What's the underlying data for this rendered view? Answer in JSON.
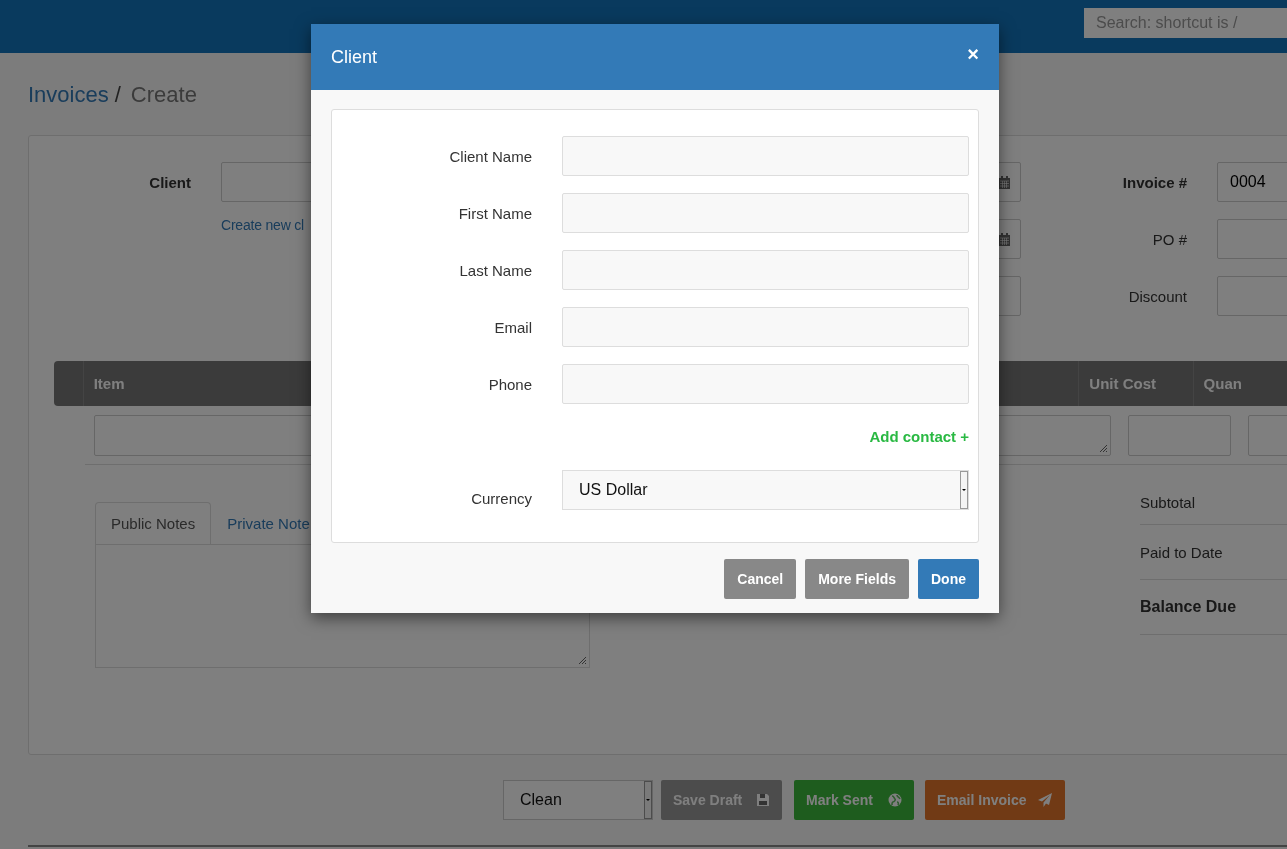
{
  "navbar": {
    "search": {
      "placeholder": "Search: shortcut is /"
    }
  },
  "breadcrumb": [
    {
      "label": "Invoices",
      "kind": "link"
    },
    {
      "label": "/",
      "kind": "separator"
    },
    {
      "label": "Create",
      "kind": "current"
    }
  ],
  "invoice_form": {
    "client": {
      "label": "Client",
      "link": "Create new cl"
    },
    "date_fields": [
      {
        "kind": "date"
      },
      {
        "kind": "date"
      },
      {
        "kind": "plain"
      }
    ],
    "right_fields": [
      {
        "label": "Invoice #",
        "value": "0004",
        "bold": true
      },
      {
        "label": "PO #",
        "bold": false
      },
      {
        "label": "Discount",
        "bold": false
      }
    ]
  },
  "table": {
    "columns": [
      "Item",
      "Unit Cost",
      "Quan"
    ]
  },
  "notes": {
    "tabs": [
      {
        "label": "Public Notes",
        "selected": true
      },
      {
        "label": "Private Note",
        "selected": false
      }
    ]
  },
  "totals": [
    {
      "label": "Subtotal",
      "bold": false
    },
    {
      "label": "Paid to Date",
      "bold": false
    },
    {
      "label": "Balance Due",
      "bold": true
    }
  ],
  "actions": {
    "status_select": {
      "value": "Clean"
    },
    "buttons": [
      {
        "label": "Save Draft",
        "kind": "save"
      },
      {
        "label": "Mark Sent",
        "kind": "sent"
      },
      {
        "label": "Email Invoice",
        "kind": "email"
      }
    ]
  },
  "modal": {
    "title": "Client",
    "close": "×",
    "fields": [
      {
        "label": "Client Name"
      },
      {
        "label": "First Name"
      },
      {
        "label": "Last Name"
      },
      {
        "label": "Email"
      },
      {
        "label": "Phone"
      }
    ],
    "add_contact": "Add contact +",
    "currency": {
      "label": "Currency",
      "value": "US Dollar"
    },
    "buttons": [
      {
        "label": "Cancel",
        "kind": "secondary"
      },
      {
        "label": "More Fields",
        "kind": "secondary"
      },
      {
        "label": "Done",
        "kind": "primary"
      }
    ]
  }
}
